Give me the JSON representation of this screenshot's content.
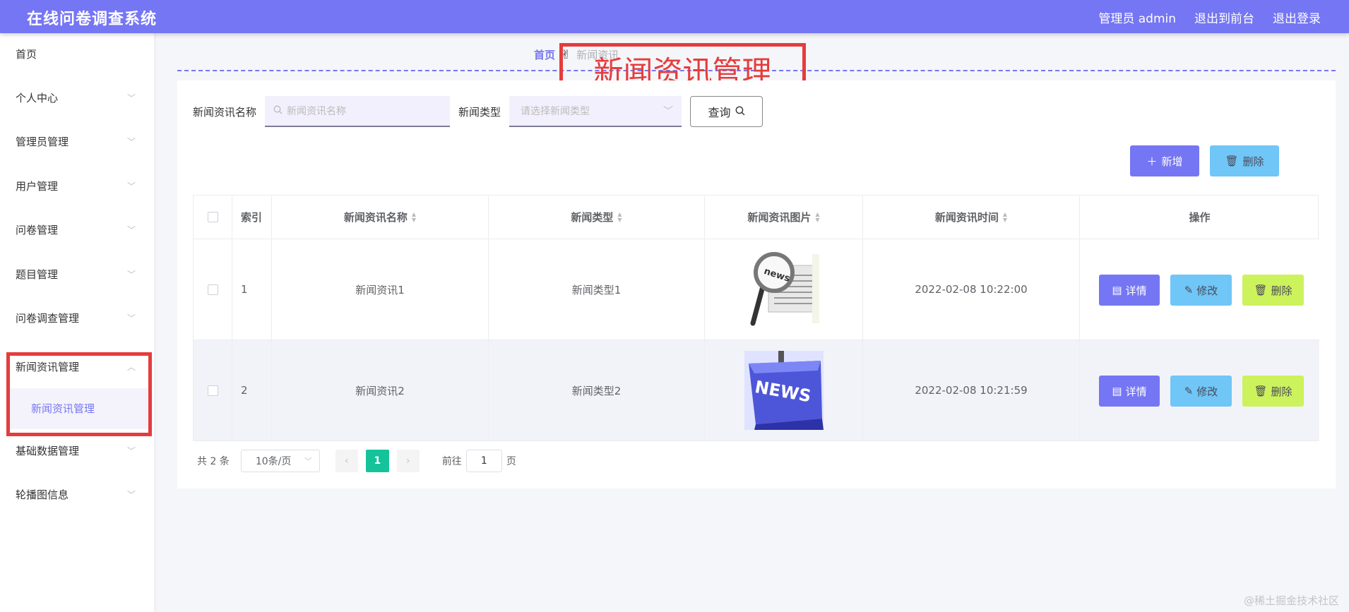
{
  "header": {
    "app_title": "在线问卷调查系统",
    "user_label": "管理员 admin",
    "back_to_front": "退出到前台",
    "logout": "退出登录"
  },
  "sidebar": {
    "items": [
      {
        "label": "首页",
        "has_chevron": false
      },
      {
        "label": "个人中心",
        "has_chevron": true
      },
      {
        "label": "管理员管理",
        "has_chevron": true
      },
      {
        "label": "用户管理",
        "has_chevron": true
      },
      {
        "label": "问卷管理",
        "has_chevron": true
      },
      {
        "label": "题目管理",
        "has_chevron": true
      },
      {
        "label": "问卷调查管理",
        "has_chevron": true
      },
      {
        "label": "新闻资讯管理",
        "has_chevron": true,
        "expanded": true
      },
      {
        "label": "基础数据管理",
        "has_chevron": true
      },
      {
        "label": "轮播图信息",
        "has_chevron": true
      }
    ],
    "active_sub": "新闻资讯管理"
  },
  "breadcrumb": {
    "home": "首页",
    "current": "新闻资讯"
  },
  "annotation": {
    "title": "新闻资讯管理",
    "color": "#e53c3c"
  },
  "search": {
    "name_label": "新闻资讯名称",
    "name_placeholder": "新闻资讯名称",
    "type_label": "新闻类型",
    "type_placeholder": "请选择新闻类型",
    "query_button": "查询"
  },
  "actions": {
    "add": "新增",
    "delete": "删除"
  },
  "table": {
    "columns": [
      "索引",
      "新闻资讯名称",
      "新闻类型",
      "新闻资讯图片",
      "新闻资讯时间",
      "操作"
    ],
    "rows": [
      {
        "index": "1",
        "name": "新闻资讯1",
        "type": "新闻类型1",
        "image": "news-magnifier",
        "time": "2022-02-08 10:22:00"
      },
      {
        "index": "2",
        "name": "新闻资讯2",
        "type": "新闻类型2",
        "image": "news-keyboard-key",
        "time": "2022-02-08 10:21:59"
      }
    ],
    "row_actions": {
      "detail": "详情",
      "edit": "修改",
      "delete": "删除"
    }
  },
  "pagination": {
    "total_text": "共 2 条",
    "page_size": "10条/页",
    "current_page": "1",
    "goto_label": "前往",
    "goto_value": "1",
    "page_suffix": "页"
  },
  "watermark": "@稀土掘金技术社区",
  "colors": {
    "primary": "#7576f3",
    "info": "#6fc6f7",
    "lime": "#ccf25c",
    "success": "#15c39a",
    "annotation_red": "#e53c3c"
  }
}
